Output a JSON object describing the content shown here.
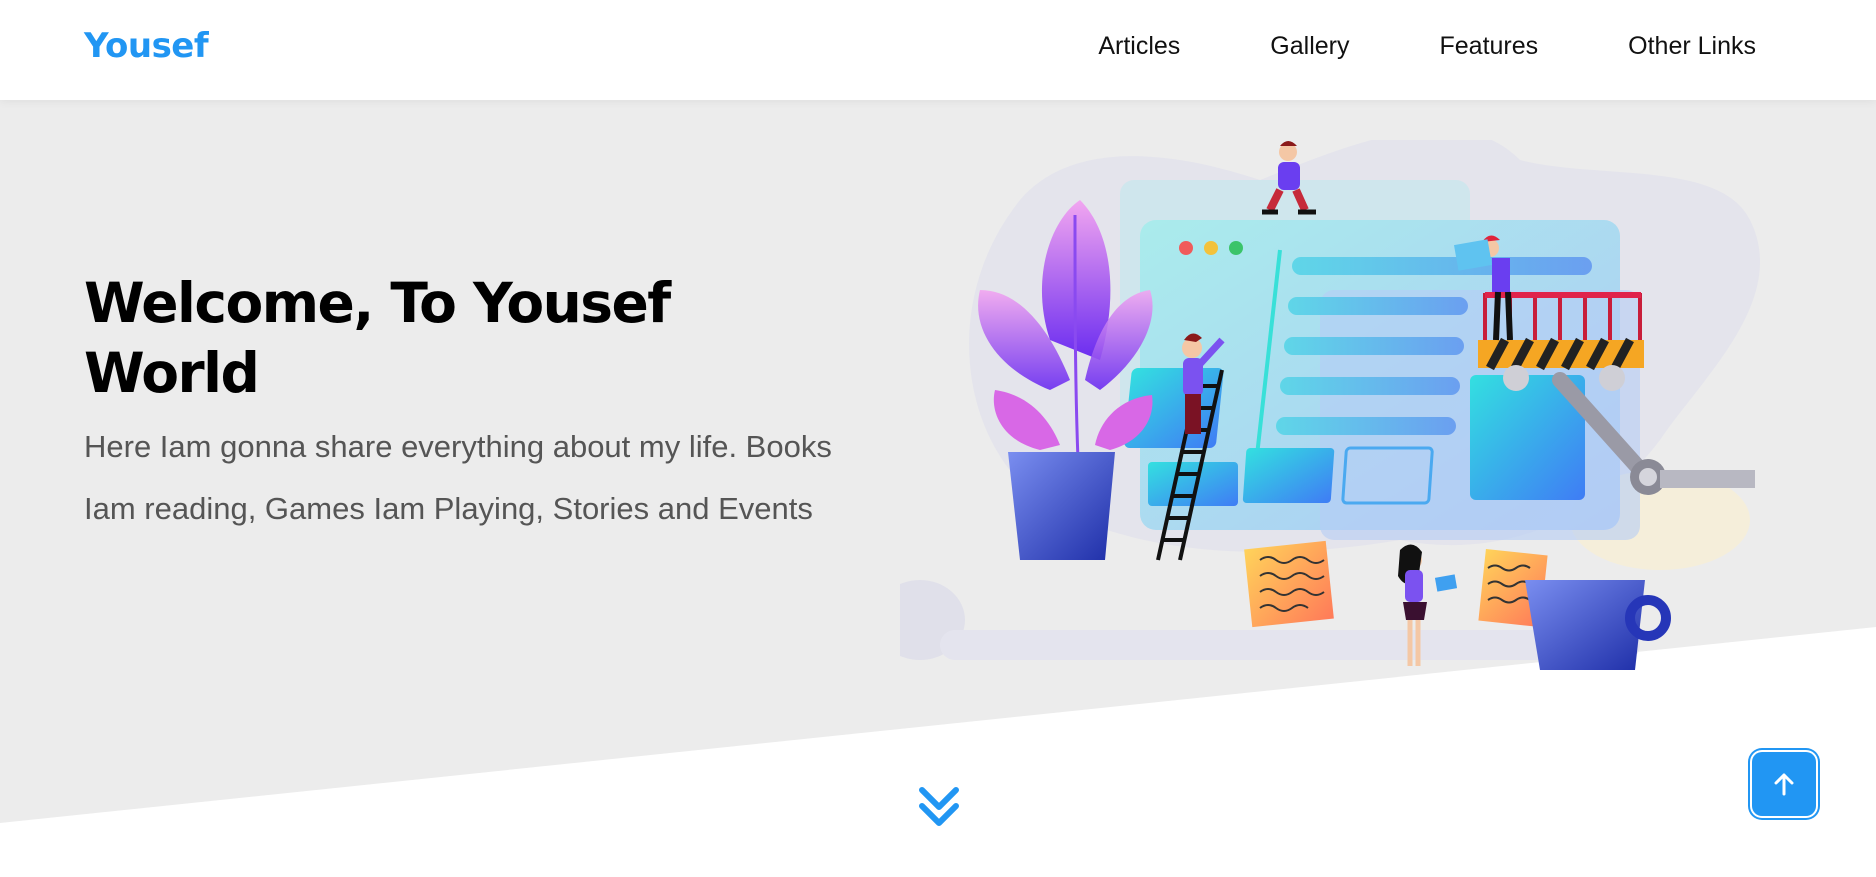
{
  "header": {
    "logo": "Yousef",
    "nav": [
      {
        "label": "Articles"
      },
      {
        "label": "Gallery"
      },
      {
        "label": "Features"
      },
      {
        "label": "Other Links"
      }
    ]
  },
  "hero": {
    "title": "Welcome, To Yousef World",
    "description": "Here Iam gonna share everything about my life. Books Iam reading, Games Iam Playing, Stories and Events",
    "illustration_icon": "website-building-illustration"
  },
  "controls": {
    "scroll_down_icon": "chevron-double-down-icon",
    "scroll_top_icon": "arrow-up-icon"
  },
  "colors": {
    "accent": "#2196f3",
    "hero_background": "#ececec",
    "text_dark": "#000000",
    "text_muted": "#555555"
  }
}
